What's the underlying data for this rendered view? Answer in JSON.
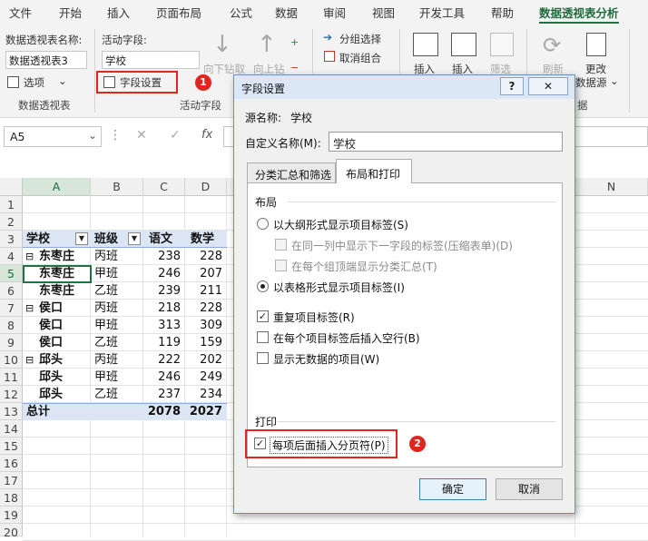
{
  "ribbon_tabs": [
    "文件",
    "开始",
    "插入",
    "页面布局",
    "公式",
    "数据",
    "审阅",
    "视图",
    "开发工具",
    "帮助",
    "数据透视表分析"
  ],
  "ribbon": {
    "pivot_name_label": "数据透视表名称:",
    "pivot_name_value": "数据透视表3",
    "options_label": "选项",
    "group_pivot": "数据透视表",
    "active_field_label": "活动字段:",
    "active_field_value": "学校",
    "field_settings_label": "字段设置",
    "drill_down": "向下钻取",
    "drill_up": "向上钻",
    "group_active_field": "活动字段",
    "group_selection": "分组选择",
    "ungroup": "取消组合",
    "insert_slicer": "插入",
    "insert_timeline": "插入",
    "filter_conn": "筛选",
    "refresh": "刷新",
    "change_source_1": "更改",
    "change_source_2": "数据源",
    "group_data_partial": "据",
    "badge1": "1"
  },
  "formula_bar": {
    "name_box": "A5",
    "fx": "fx"
  },
  "columns": [
    "A",
    "B",
    "C",
    "D",
    "N"
  ],
  "rows": [
    "1",
    "2",
    "3",
    "4",
    "5",
    "6",
    "7",
    "8",
    "9",
    "10",
    "11",
    "12",
    "13",
    "14",
    "15",
    "16",
    "17",
    "18",
    "19",
    "20"
  ],
  "pivot": {
    "headers": [
      "学校",
      "班级",
      "语文",
      "数学"
    ],
    "rows": [
      {
        "school": "东枣庄",
        "collapse": "⊟",
        "class": "丙班",
        "chinese": "238",
        "math": "228"
      },
      {
        "school": "东枣庄",
        "collapse": "",
        "class": "甲班",
        "chinese": "246",
        "math": "207"
      },
      {
        "school": "东枣庄",
        "collapse": "",
        "class": "乙班",
        "chinese": "239",
        "math": "211"
      },
      {
        "school": "侯口",
        "collapse": "⊟",
        "class": "丙班",
        "chinese": "218",
        "math": "228"
      },
      {
        "school": "侯口",
        "collapse": "",
        "class": "甲班",
        "chinese": "313",
        "math": "309"
      },
      {
        "school": "侯口",
        "collapse": "",
        "class": "乙班",
        "chinese": "119",
        "math": "159"
      },
      {
        "school": "邱头",
        "collapse": "⊟",
        "class": "丙班",
        "chinese": "222",
        "math": "202"
      },
      {
        "school": "邱头",
        "collapse": "",
        "class": "甲班",
        "chinese": "246",
        "math": "249"
      },
      {
        "school": "邱头",
        "collapse": "",
        "class": "乙班",
        "chinese": "237",
        "math": "234"
      }
    ],
    "total_label": "总计",
    "total_chinese": "2078",
    "total_math": "2027"
  },
  "dialog": {
    "title": "字段设置",
    "help": "?",
    "close": "✕",
    "source_label": "源名称:",
    "source_value": "学校",
    "custom_label": "自定义名称(M):",
    "custom_value": "学校",
    "tab1": "分类汇总和筛选",
    "tab2": "布局和打印",
    "section_layout": "布局",
    "opt_outline": "以大纲形式显示项目标签(S)",
    "opt_compact": "在同一列中显示下一字段的标签(压缩表单)(D)",
    "opt_subtotal_top": "在每个组顶端显示分类汇总(T)",
    "opt_tabular": "以表格形式显示项目标签(I)",
    "repeat_labels": "重复项目标签(R)",
    "blank_line": "在每个项目标签后插入空行(B)",
    "show_no_data": "显示无数据的项目(W)",
    "section_print": "打印",
    "page_break": "每项后面插入分页符(P)",
    "badge2": "2",
    "ok": "确定",
    "cancel": "取消"
  }
}
